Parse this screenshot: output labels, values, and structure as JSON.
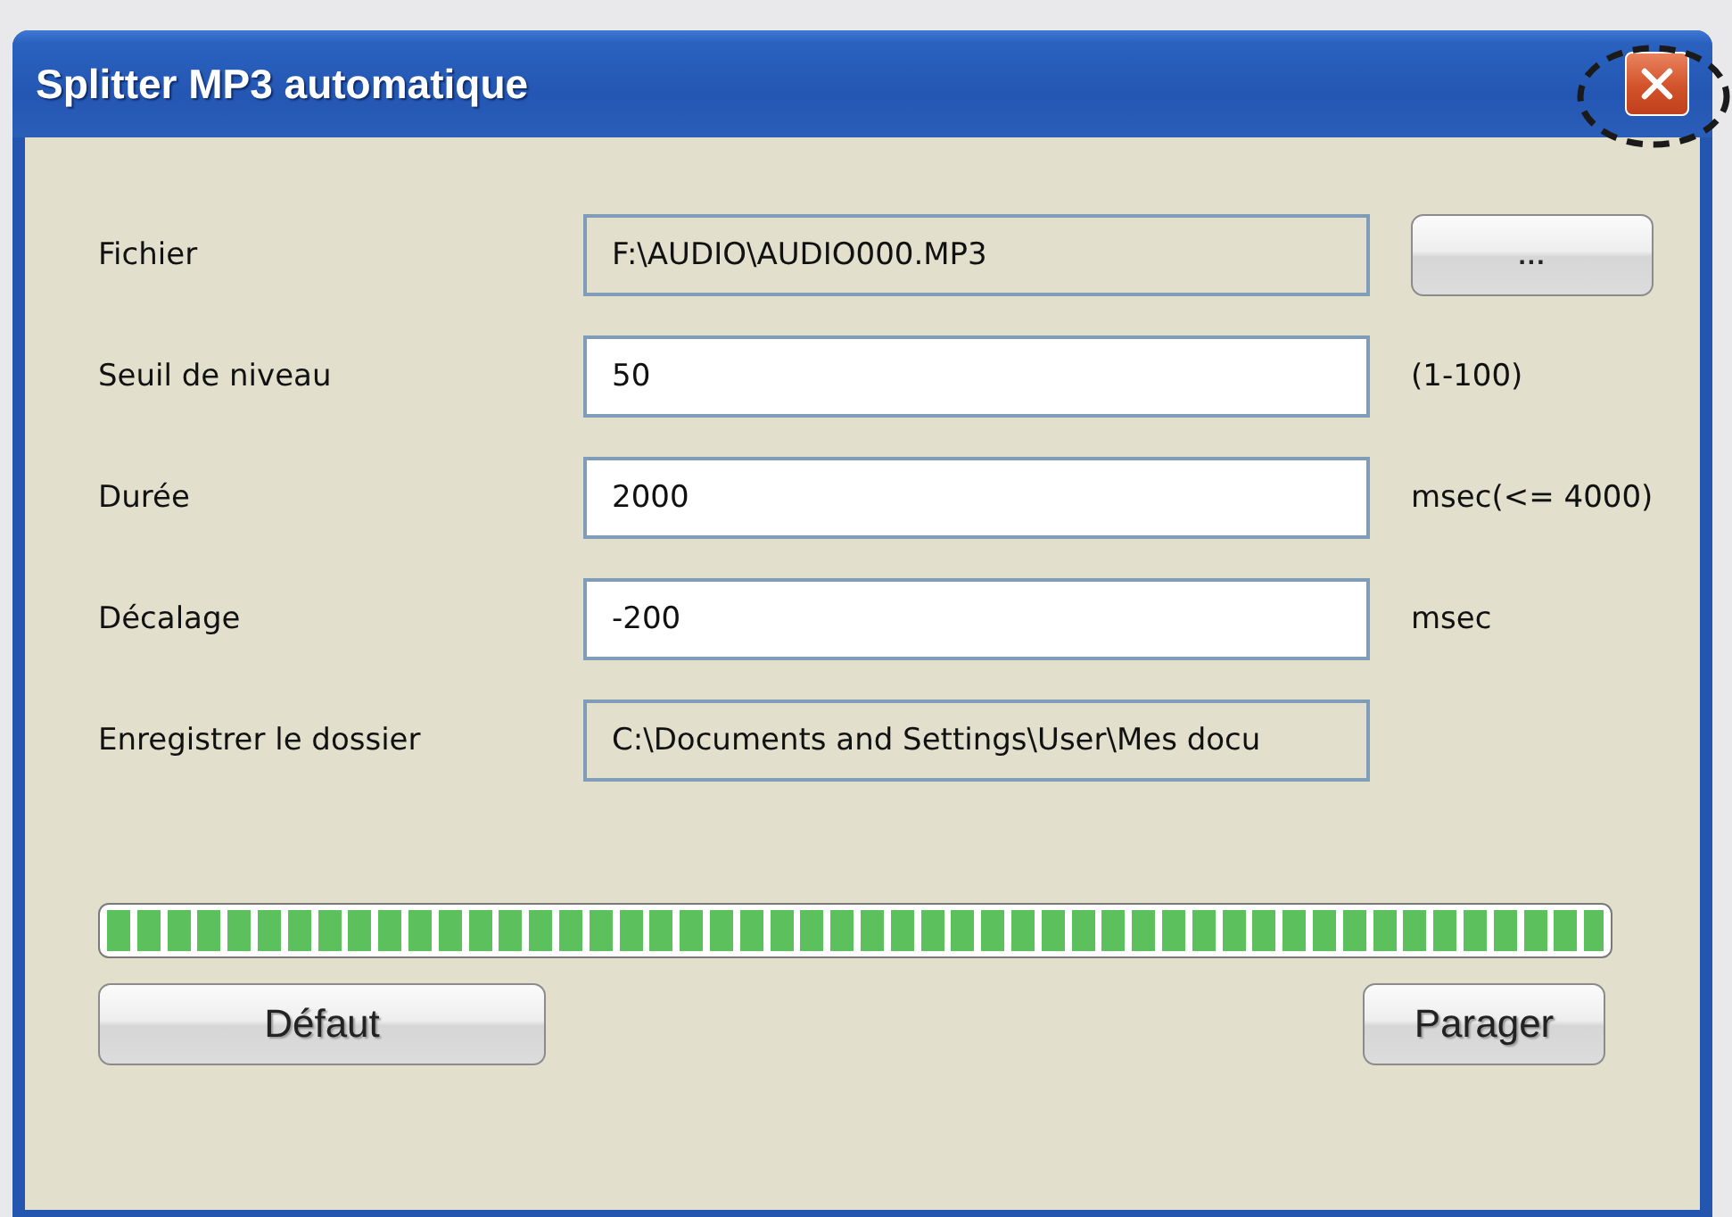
{
  "window": {
    "title": "Splitter MP3 automatique",
    "close_button": {
      "highlighted": true
    }
  },
  "rows": [
    {
      "label": "Fichier",
      "value": "F:\\AUDIO\\AUDIO000.MP3",
      "readonly": true,
      "button": "..."
    },
    {
      "label": "Seuil de niveau",
      "value": "50",
      "readonly": false,
      "unit": "(1-100)"
    },
    {
      "label": "Durée",
      "value": "2000",
      "readonly": false,
      "unit": "msec(<= 4000)"
    },
    {
      "label": "Décalage",
      "value": "-200",
      "readonly": false,
      "unit": "msec"
    },
    {
      "label": "Enregistrer le dossier",
      "value": "C:\\Documents and Settings\\User\\Mes docu",
      "readonly": true
    }
  ],
  "progress": {
    "level": 1
  },
  "buttons": [
    "Défaut",
    "Parager"
  ]
}
